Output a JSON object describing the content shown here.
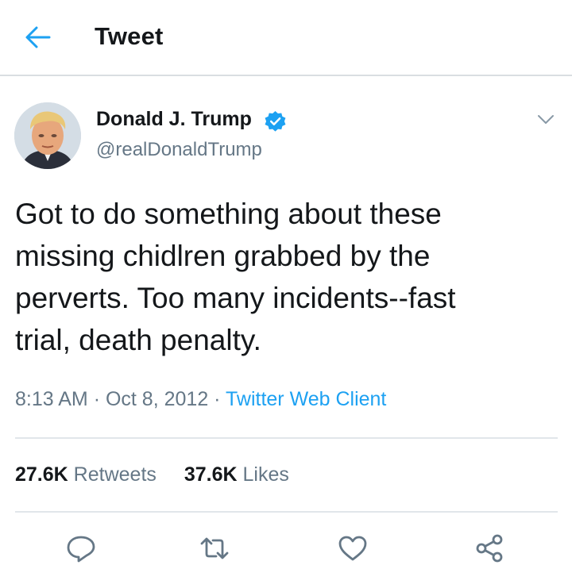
{
  "header": {
    "title": "Tweet"
  },
  "author": {
    "display_name": "Donald J. Trump",
    "handle": "@realDonaldTrump",
    "verified": true
  },
  "tweet": {
    "lines": [
      "Got to do something about these",
      "missing chidlren grabbed by the",
      "perverts. Too many incidents--fast",
      "trial, death penalty."
    ],
    "time": "8:13 AM",
    "date": "Oct 8, 2012",
    "separator": "·",
    "client": "Twitter Web Client"
  },
  "stats": {
    "retweets_count": "27.6K",
    "retweets_label": "Retweets",
    "likes_count": "37.6K",
    "likes_label": "Likes"
  },
  "icons": {
    "back": "arrow-left-icon",
    "verified": "verified-badge-icon",
    "caret": "chevron-down-icon",
    "reply": "reply-icon",
    "retweet": "retweet-icon",
    "like": "heart-icon",
    "share": "share-icon"
  },
  "colors": {
    "accent": "#1da1f2",
    "text": "#14171a",
    "muted": "#657786",
    "divider": "#e1e6ea"
  }
}
